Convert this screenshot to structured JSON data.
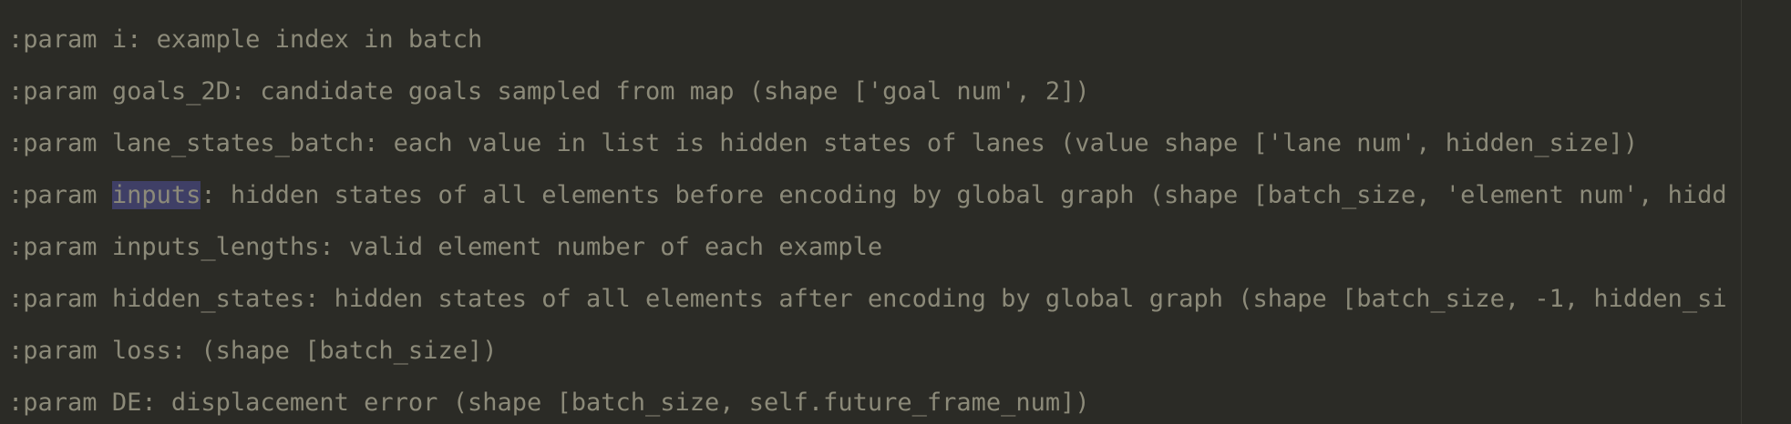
{
  "editor": {
    "lines": [
      {
        "tag": ":param",
        "name": "i",
        "rest": ": example index in batch"
      },
      {
        "tag": ":param",
        "name": "goals_2D",
        "rest": ": candidate goals sampled from map (shape ['goal num', 2])"
      },
      {
        "tag": ":param",
        "name": "lane_states_batch",
        "rest": ": each value in list is hidden states of lanes (value shape ['lane num', hidden_size])"
      },
      {
        "tag": ":param",
        "name": "inputs",
        "rest": ": hidden states of all elements before encoding by global graph (shape [batch_size, 'element num', hidd"
      },
      {
        "tag": ":param",
        "name": "inputs_lengths",
        "rest": ": valid element number of each example"
      },
      {
        "tag": ":param",
        "name": "hidden_states",
        "rest": ": hidden states of all elements after encoding by global graph (shape [batch_size, -1, hidden_si"
      },
      {
        "tag": ":param",
        "name": "loss",
        "rest": ": (shape [batch_size])"
      },
      {
        "tag": ":param",
        "name": "DE",
        "rest": ": displacement error (shape [batch_size, self.future_frame_num])"
      }
    ]
  }
}
